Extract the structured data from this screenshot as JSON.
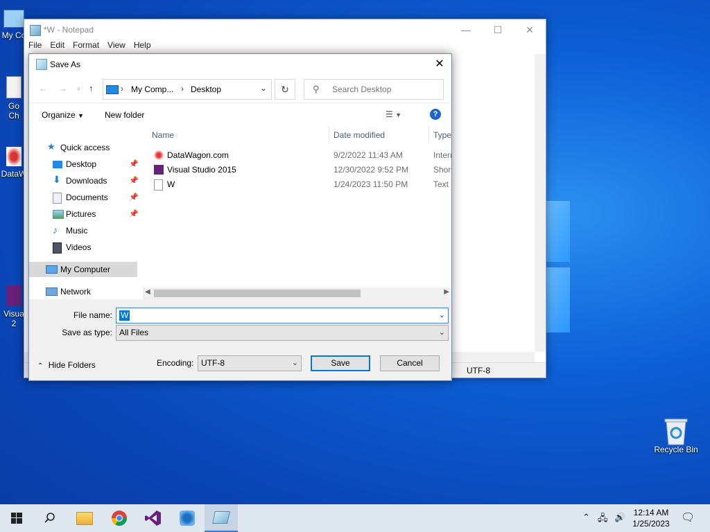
{
  "desktop": {
    "icons": [
      {
        "label": "My Co"
      },
      {
        "label": "Go Ch"
      },
      {
        "label": "DataW"
      },
      {
        "label": "Visua 2"
      }
    ],
    "recycle_bin": "Recycle Bin"
  },
  "notepad": {
    "title": "*W - Notepad",
    "menu": [
      "File",
      "Edit",
      "Format",
      "View",
      "Help"
    ],
    "status_encoding": "UTF-8"
  },
  "dialog": {
    "title": "Save As",
    "breadcrumbs": [
      "My Comp...",
      "Desktop"
    ],
    "search_placeholder": "Search Desktop",
    "toolbar": {
      "organize": "Organize",
      "new_folder": "New folder"
    },
    "nav": [
      {
        "label": "Quick access",
        "pinned": false
      },
      {
        "label": "Desktop",
        "pinned": true
      },
      {
        "label": "Downloads",
        "pinned": true
      },
      {
        "label": "Documents",
        "pinned": true
      },
      {
        "label": "Pictures",
        "pinned": true
      },
      {
        "label": "Music",
        "pinned": false
      },
      {
        "label": "Videos",
        "pinned": false
      },
      {
        "label": "My Computer",
        "pinned": false
      },
      {
        "label": "Network",
        "pinned": false
      }
    ],
    "columns": {
      "name": "Name",
      "date": "Date modified",
      "type": "Type"
    },
    "files": [
      {
        "name": "DataWagon.com",
        "date": "9/2/2022 11:43 AM",
        "type": "Intern"
      },
      {
        "name": "Visual Studio 2015",
        "date": "12/30/2022 9:52 PM",
        "type": "Short"
      },
      {
        "name": "W",
        "date": "1/24/2023 11:50 PM",
        "type": "Text D"
      }
    ],
    "file_name_label": "File name:",
    "file_name_value": "W",
    "save_type_label": "Save as type:",
    "save_type_value": "All Files",
    "hide_folders": "Hide Folders",
    "encoding_label": "Encoding:",
    "encoding_value": "UTF-8",
    "save": "Save",
    "cancel": "Cancel"
  },
  "taskbar": {
    "time": "12:14 AM",
    "date": "1/25/2023"
  }
}
